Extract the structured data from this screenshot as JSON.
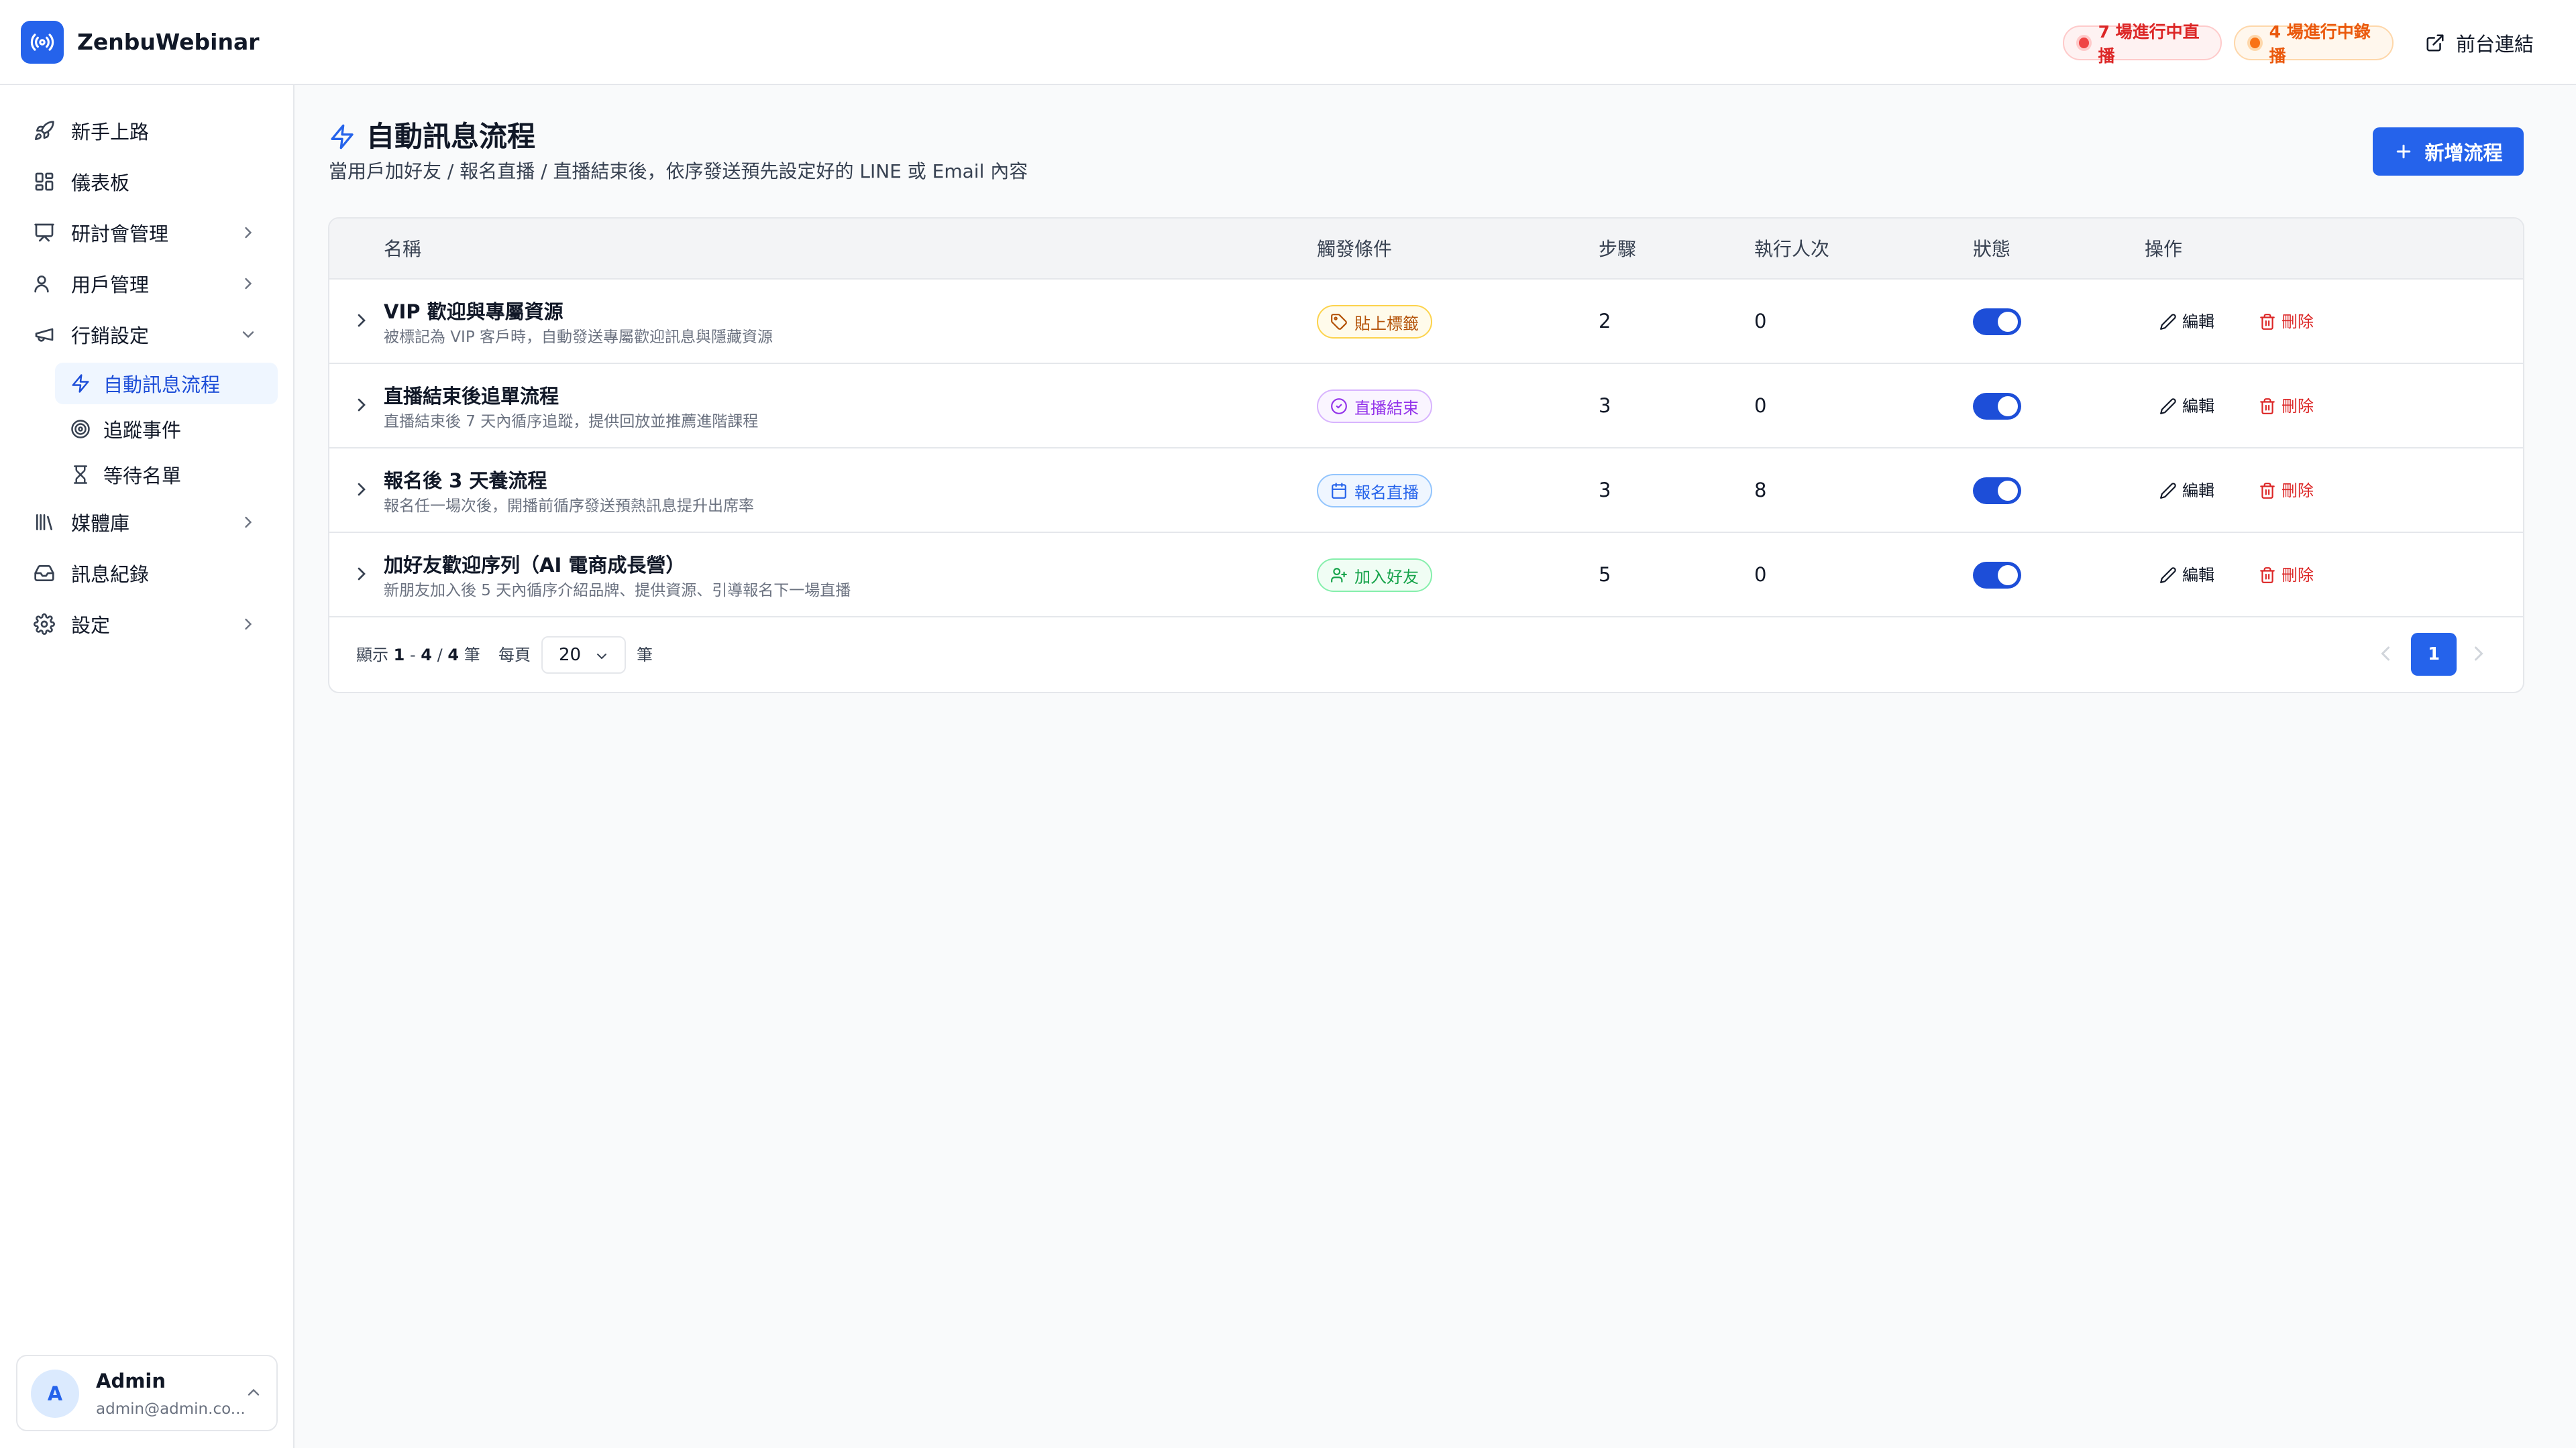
{
  "app": {
    "name": "ZenbuWebinar",
    "logo_icon": "broadcast-icon",
    "accent": "#2563eb"
  },
  "topbar": {
    "live_badge": "7 場進行中直播",
    "rec_badge": "4 場進行中錄播",
    "frontend_link": "前台連結"
  },
  "sidebar": {
    "items": [
      {
        "label": "新手上路",
        "icon": "rocket-icon"
      },
      {
        "label": "儀表板",
        "icon": "dashboard-icon"
      },
      {
        "label": "研討會管理",
        "icon": "presentation-icon"
      },
      {
        "label": "用戶管理",
        "icon": "users-icon"
      },
      {
        "label": "行銷設定",
        "icon": "megaphone-icon"
      },
      {
        "label": "媒體庫",
        "icon": "library-icon"
      },
      {
        "label": "訊息紀錄",
        "icon": "inbox-icon"
      },
      {
        "label": "設定",
        "icon": "gear-icon"
      }
    ],
    "subitems": [
      {
        "label": "自動訊息流程",
        "icon": "lightning-icon",
        "active": true
      },
      {
        "label": "追蹤事件",
        "icon": "target-icon"
      },
      {
        "label": "等待名單",
        "icon": "hourglass-icon"
      }
    ],
    "user": {
      "initial": "A",
      "name": "Admin",
      "email": "admin@admin.co..."
    }
  },
  "page": {
    "title": "自動訊息流程",
    "description": "當用戶加好友 / 報名直播 / 直播結束後，依序發送預先設定好的 LINE 或 Email 內容",
    "add_button": "新增流程"
  },
  "table": {
    "headers": {
      "name": "名稱",
      "trigger": "觸發條件",
      "steps": "步驟",
      "runs": "執行人次",
      "status": "狀態",
      "actions": "操作"
    },
    "rows": [
      {
        "name": "VIP 歡迎與專屬資源",
        "desc": "被標記為 VIP 客戶時，自動發送專屬歡迎訊息與隱藏資源",
        "trigger": "貼上標籤",
        "trigger_icon": "tag-icon",
        "trigger_color": "#b45309",
        "steps": "2",
        "runs": "0",
        "enabled": true
      },
      {
        "name": "直播結束後追單流程",
        "desc": "直播結束後 7 天內循序追蹤，提供回放並推薦進階課程",
        "trigger": "直播結束",
        "trigger_icon": "check-circle-icon",
        "trigger_color": "#9333ea",
        "steps": "3",
        "runs": "0",
        "enabled": true
      },
      {
        "name": "報名後 3 天養流程",
        "desc": "報名任一場次後，開播前循序發送預熱訊息提升出席率",
        "trigger": "報名直播",
        "trigger_icon": "calendar-icon",
        "trigger_color": "#2563eb",
        "steps": "3",
        "runs": "8",
        "enabled": true
      },
      {
        "name": "加好友歡迎序列（AI 電商成長營）",
        "desc": "新朋友加入後 5 天內循序介紹品牌、提供資源、引導報名下一場直播",
        "trigger": "加入好友",
        "trigger_icon": "user-plus-icon",
        "trigger_color": "#16a34a",
        "steps": "5",
        "runs": "0",
        "enabled": true
      }
    ],
    "edit_label": "編輯",
    "delete_label": "刪除"
  },
  "footer": {
    "showing_prefix": "顯示",
    "range_start": "1",
    "range_end": "4",
    "total": "4",
    "unit": "筆",
    "per_page_label": "每頁",
    "per_page_value": "20",
    "current_page": "1"
  }
}
